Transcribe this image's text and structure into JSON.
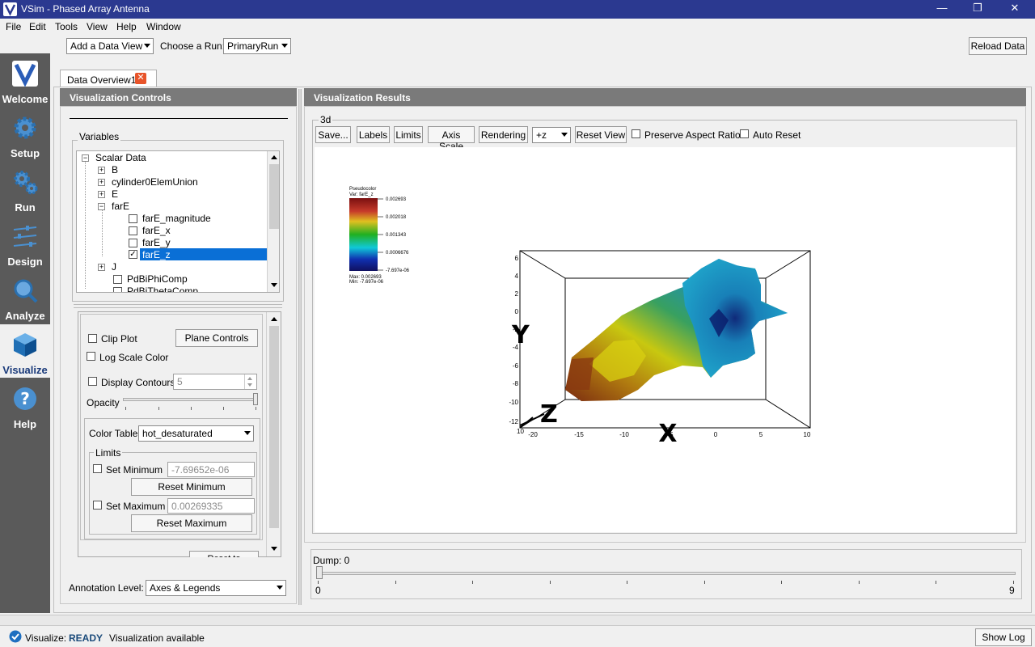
{
  "window": {
    "title": "VSim - Phased Array Antenna",
    "minimize_glyph": "—",
    "restore_glyph": "❐",
    "close_glyph": "✕"
  },
  "menu": [
    "File",
    "Edit",
    "Tools",
    "View",
    "Help",
    "Window"
  ],
  "nav": [
    {
      "label": "Welcome",
      "icon": "vsim-logo-icon"
    },
    {
      "label": "Setup",
      "icon": "gear-icon"
    },
    {
      "label": "Run",
      "icon": "gears-icon"
    },
    {
      "label": "Design",
      "icon": "sliders-icon"
    },
    {
      "label": "Analyze",
      "icon": "magnifier-icon"
    },
    {
      "label": "Visualize",
      "icon": "cube-icon"
    },
    {
      "label": "Help",
      "icon": "question-icon"
    }
  ],
  "toolbar": {
    "add_data_view": "Add a Data View",
    "choose_run_label": "Choose a Run:",
    "run_value": "PrimaryRun",
    "reload": "Reload Data"
  },
  "tab": {
    "label": "Data Overview1"
  },
  "controls": {
    "header": "Visualization Controls",
    "variables_label": "Variables",
    "tree": [
      {
        "label": "Scalar Data",
        "level": 0,
        "expander": "−"
      },
      {
        "label": "B",
        "level": 1,
        "expander": "+"
      },
      {
        "label": "cylinder0ElemUnion",
        "level": 1,
        "expander": "+"
      },
      {
        "label": "E",
        "level": 1,
        "expander": "+"
      },
      {
        "label": "farE",
        "level": 1,
        "expander": "−"
      },
      {
        "label": "farE_magnitude",
        "level": 2,
        "checked": false
      },
      {
        "label": "farE_x",
        "level": 2,
        "checked": false
      },
      {
        "label": "farE_y",
        "level": 2,
        "checked": false
      },
      {
        "label": "farE_z",
        "level": 2,
        "checked": true,
        "selected": true
      },
      {
        "label": "J",
        "level": 1,
        "expander": "+"
      },
      {
        "label": "PdBiPhiComp",
        "level": 1,
        "checked": false
      },
      {
        "label": "PdBiThetaComp",
        "level": 1,
        "checked": false
      }
    ],
    "clip_plot": "Clip Plot",
    "plane_controls": "Plane Controls",
    "log_scale": "Log Scale Color",
    "display_contours": "Display Contours",
    "contours_value": "5",
    "opacity": "Opacity",
    "color_table_label": "Color Table",
    "color_table_value": "hot_desaturated",
    "limits_label": "Limits",
    "set_minimum": "Set Minimum",
    "min_value": "-7.69652e-06",
    "reset_minimum": "Reset Minimum",
    "set_maximum": "Set Maximum",
    "max_value": "0.00269335",
    "reset_maximum": "Reset Maximum",
    "reset_defaults": "Reset to Defaults",
    "annotation_label": "Annotation Level:",
    "annotation_value": "Axes & Legends"
  },
  "results": {
    "header": "Visualization Results",
    "group_label": "3d",
    "save": "Save...",
    "labels": "Labels",
    "limits": "Limits",
    "axis_scale": "Axis Scale",
    "rendering": "Rendering",
    "view_value": "+z",
    "reset_view": "Reset View",
    "preserve_aspect": "Preserve Aspect Ratio",
    "auto_reset": "Auto Reset",
    "legend": {
      "title": "Pseudocolor",
      "var": "Var: farE_z",
      "ticks": [
        "0.002693",
        "0.002018",
        "0.001343",
        "0.0006676",
        "-7.697e-06"
      ],
      "max": "Max: 0.002693",
      "min": "Min: -7.697e-06"
    },
    "axes": {
      "x_label": "X",
      "y_label": "Y",
      "z_label": "Z",
      "x_ticks": [
        "-20",
        "-15",
        "-10",
        "-5",
        "0",
        "5",
        "10"
      ],
      "y_ticks": [
        "6",
        "4",
        "2",
        "0",
        "-2",
        "-4",
        "-6",
        "-8",
        "-10",
        "-12"
      ],
      "z_tick": "10"
    }
  },
  "dump": {
    "label": "Dump: 0",
    "min": "0",
    "max": "9",
    "value": 0
  },
  "status": {
    "prefix": "Visualize:",
    "state": "READY",
    "message": "Visualization available",
    "show_log": "Show Log"
  }
}
